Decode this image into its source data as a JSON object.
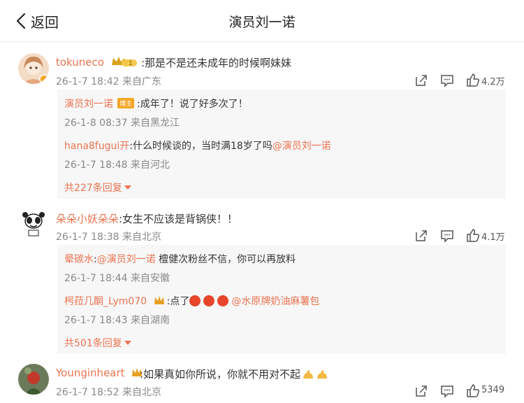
{
  "header": {
    "back_label": "返回",
    "title": "演员刘一诺"
  },
  "comments": [
    {
      "username": "tokuneco",
      "level": "1",
      "text": ":那是不是还未成年的时候啊妹妹",
      "meta": "26-1-7 18:42 来自广东",
      "likes": "4.2万",
      "replies": [
        {
          "name": "演员刘一诺",
          "badge": "博主",
          "text": ":成年了！说了好多次了！",
          "mention": "",
          "meta": "26-1-8 08:37 来自黑龙江"
        },
        {
          "name": "hana8fugui开",
          "badge": "",
          "text": ":什么时候谈的，当时满18岁了吗",
          "mention": "@演员刘一诺",
          "meta": "26-1-7 18:48 来自河北"
        }
      ],
      "more": "共227条回复"
    },
    {
      "username": "朵朵小妖朵朵",
      "text": ":女生不应该是背锅侠！！",
      "meta": "26-1-7 18:38 来自北京",
      "likes": "4.1万",
      "replies": [
        {
          "name": "晕碳水",
          "text_prefix": ":",
          "mention": "@演员刘一诺",
          "text": " 檀健次粉丝不信，你可以再放料",
          "meta": "26-1-7 18:44 来自安徽"
        },
        {
          "name": "枵菈几酮_Lym070",
          "text": ":点了",
          "mention": "@水原牌奶油麻薯包",
          "meta": "26-1-7 18:43 来自湖南"
        }
      ],
      "more": "共501条回复"
    },
    {
      "username": "Younginheart",
      "text": ":如果真如你所说，你就不用对不起",
      "meta": "26-1-7 18:52 来自北京",
      "likes": "5349"
    }
  ],
  "icons": {
    "share": "share-icon",
    "comment": "comment-icon",
    "like": "like-icon",
    "back": "chevron-left-icon"
  },
  "colors": {
    "username": "#eb7350",
    "meta": "#888888",
    "reply_bg": "#f7f7f7",
    "badge": "#f5a623"
  }
}
